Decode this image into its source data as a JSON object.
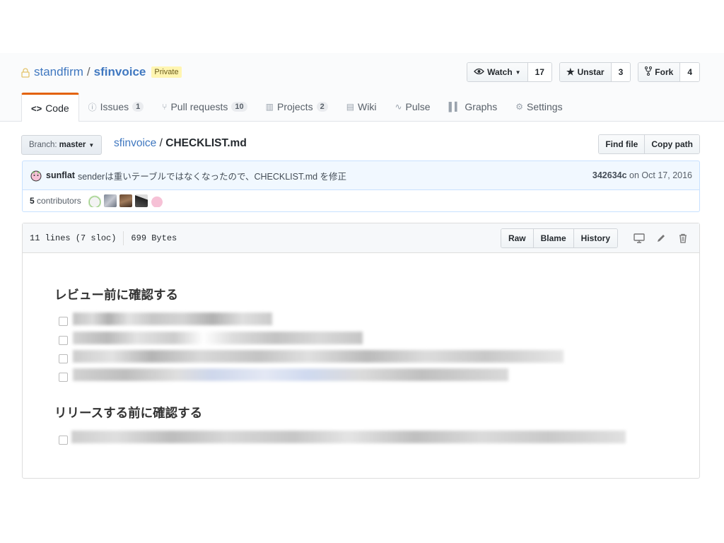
{
  "repo": {
    "owner": "standfirm",
    "separator": "/",
    "name": "sfinvoice",
    "visibility": "Private"
  },
  "actions": [
    {
      "label": "Watch",
      "icon": "eye-icon",
      "count": "17"
    },
    {
      "label": "Unstar",
      "icon": "star-icon",
      "count": "3"
    },
    {
      "label": "Fork",
      "icon": "fork-icon",
      "count": "4"
    }
  ],
  "tabs": [
    {
      "label": "Code",
      "icon": "code-icon",
      "selected": true
    },
    {
      "label": "Issues",
      "icon": "issue-icon",
      "count": "1"
    },
    {
      "label": "Pull requests",
      "icon": "pull-request-icon",
      "count": "10"
    },
    {
      "label": "Projects",
      "icon": "project-icon",
      "count": "2"
    },
    {
      "label": "Wiki",
      "icon": "book-icon"
    },
    {
      "label": "Pulse",
      "icon": "pulse-icon"
    },
    {
      "label": "Graphs",
      "icon": "graph-icon"
    },
    {
      "label": "Settings",
      "icon": "gear-icon"
    }
  ],
  "branch": {
    "prefix": "Branch:",
    "name": "master"
  },
  "breadcrumb": {
    "repo": "sfinvoice",
    "separator": "/",
    "file": "CHECKLIST.md"
  },
  "file_nav": {
    "find_file": "Find file",
    "copy_path": "Copy path"
  },
  "commit": {
    "author": "sunflat",
    "message": "senderは重いテーブルではなくなったので、CHECKLIST.md を修正",
    "sha": "342634c",
    "date": "on Oct 17, 2016"
  },
  "contributors": {
    "count": "5",
    "label": "contributors"
  },
  "file_info": {
    "lines": "11 lines (7 sloc)",
    "size": "699 Bytes"
  },
  "file_actions": {
    "raw": "Raw",
    "blame": "Blame",
    "history": "History"
  },
  "content": {
    "heading1": "レビュー前に確認する",
    "heading2": "リリースする前に確認する"
  }
}
